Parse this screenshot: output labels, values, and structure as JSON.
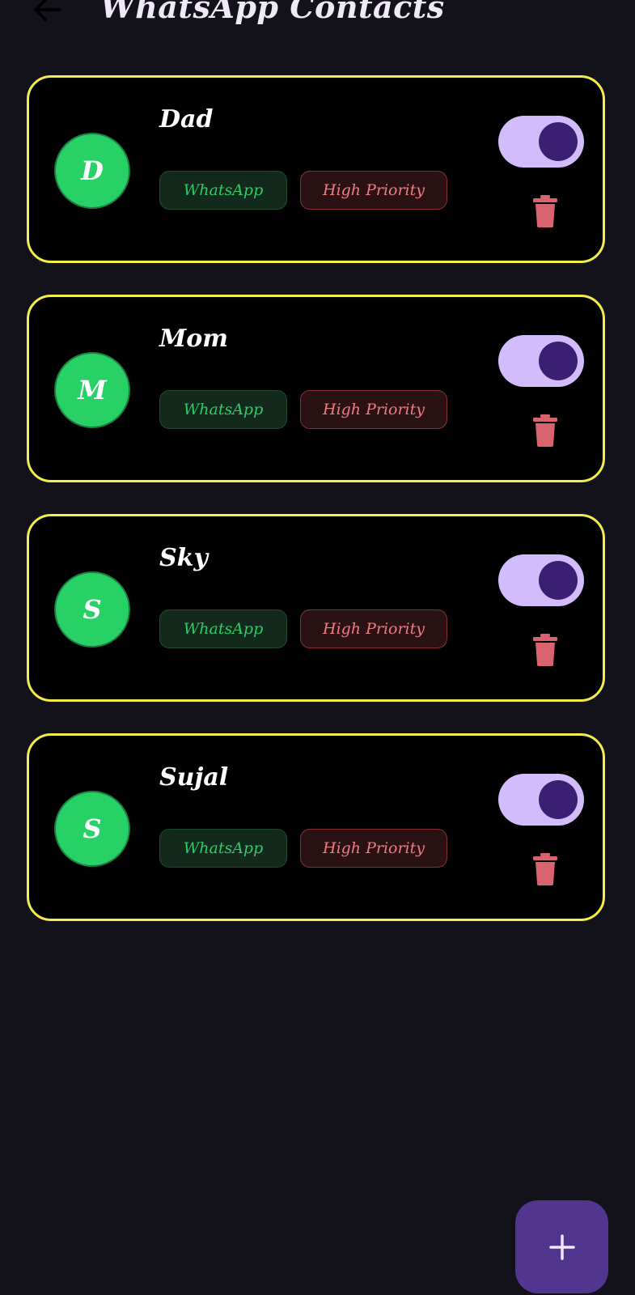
{
  "header": {
    "title": "WhatsApp Contacts"
  },
  "colors": {
    "background": "#13111a",
    "card_border": "#f2ef4a",
    "avatar_green": "#27d165",
    "toggle_track": "#d3bcfb",
    "toggle_knob": "#3b1f72",
    "delete_red": "#d8636d",
    "fab": "#52358e"
  },
  "contacts": [
    {
      "name": "Dad",
      "initial": "D",
      "channel": "WhatsApp",
      "priority": "High Priority",
      "enabled": true
    },
    {
      "name": "Mom",
      "initial": "M",
      "channel": "WhatsApp",
      "priority": "High Priority",
      "enabled": true
    },
    {
      "name": "Sky",
      "initial": "S",
      "channel": "WhatsApp",
      "priority": "High Priority",
      "enabled": true
    },
    {
      "name": "Sujal",
      "initial": "S",
      "channel": "WhatsApp",
      "priority": "High Priority",
      "enabled": true
    }
  ],
  "icons": {
    "back": "arrow-left-icon",
    "delete": "trash-icon",
    "add": "plus-icon"
  }
}
